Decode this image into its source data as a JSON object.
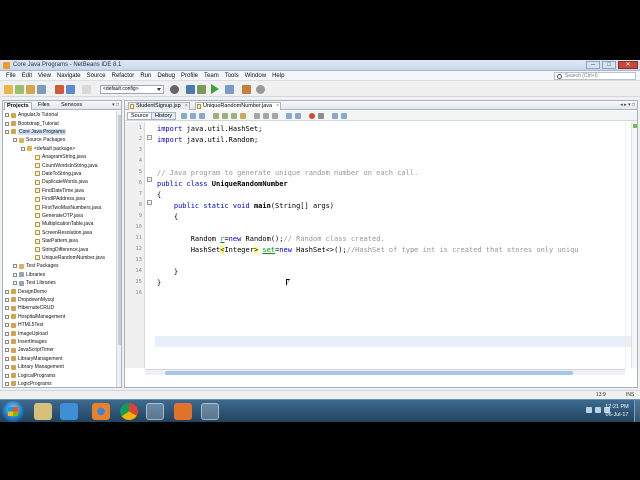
{
  "window": {
    "title": "Core Java Programs - NetBeans IDE 8.1",
    "controls": [
      "─",
      "□",
      "✕"
    ]
  },
  "menu": [
    "File",
    "Edit",
    "View",
    "Navigate",
    "Source",
    "Refactor",
    "Run",
    "Debug",
    "Profile",
    "Team",
    "Tools",
    "Window",
    "Help"
  ],
  "search": {
    "placeholder": "Search (Ctrl+I)"
  },
  "toolbar": {
    "config": "<default config>"
  },
  "panel": {
    "tabs": [
      "Projects",
      "Files",
      "Services"
    ],
    "controls": "▾ □"
  },
  "tree": [
    {
      "label": "AngularJs Tutorial",
      "type": "project",
      "depth": 0
    },
    {
      "label": "Bootstrap_Tutorial",
      "type": "project",
      "depth": 0
    },
    {
      "label": "Core Java Programs",
      "type": "project",
      "depth": 0,
      "selected": true
    },
    {
      "label": "Source Packages",
      "type": "folder",
      "depth": 1
    },
    {
      "label": "<default package>",
      "type": "package",
      "depth": 2
    },
    {
      "label": "AnagramString.java",
      "type": "java",
      "depth": 3
    },
    {
      "label": "CountWordsInString.java",
      "type": "java",
      "depth": 3
    },
    {
      "label": "DateToString.java",
      "type": "java",
      "depth": 3
    },
    {
      "label": "DuplicateWords.java",
      "type": "java",
      "depth": 3
    },
    {
      "label": "FindDateTime.java",
      "type": "java",
      "depth": 3
    },
    {
      "label": "FindIPAddress.java",
      "type": "java",
      "depth": 3
    },
    {
      "label": "FirstTwoMaxNumbers.java",
      "type": "java",
      "depth": 3
    },
    {
      "label": "GenerateOTP.java",
      "type": "java",
      "depth": 3
    },
    {
      "label": "MultiplicationTable.java",
      "type": "java",
      "depth": 3
    },
    {
      "label": "ScreenResolution.java",
      "type": "java",
      "depth": 3
    },
    {
      "label": "StarPattern.java",
      "type": "java",
      "depth": 3
    },
    {
      "label": "StringDifference.java",
      "type": "java",
      "depth": 3
    },
    {
      "label": "UniqueRandomNumber.java",
      "type": "java",
      "depth": 3
    },
    {
      "label": "Test Packages",
      "type": "folder",
      "depth": 1
    },
    {
      "label": "Libraries",
      "type": "lib",
      "depth": 1
    },
    {
      "label": "Test Libraries",
      "type": "lib",
      "depth": 1
    },
    {
      "label": "DesignDemo",
      "type": "project",
      "depth": 0
    },
    {
      "label": "DropdownMysql",
      "type": "project",
      "depth": 0
    },
    {
      "label": "HibernateCRUD",
      "type": "project",
      "depth": 0
    },
    {
      "label": "HospitalManagement",
      "type": "project",
      "depth": 0
    },
    {
      "label": "HTML5Test",
      "type": "project",
      "depth": 0
    },
    {
      "label": "ImageUpload",
      "type": "project",
      "depth": 0
    },
    {
      "label": "InsertImages",
      "type": "project",
      "depth": 0
    },
    {
      "label": "JavaScriptTimer",
      "type": "project",
      "depth": 0
    },
    {
      "label": "LibraryManagement",
      "type": "project",
      "depth": 0
    },
    {
      "label": "Library Management",
      "type": "project",
      "depth": 0
    },
    {
      "label": "LogicalPrograms",
      "type": "project",
      "depth": 0
    },
    {
      "label": "LogicPrograms",
      "type": "project",
      "depth": 0
    }
  ],
  "editor": {
    "tabs": [
      "StudentSignup.jsp",
      "UniqueRandomNumber.java"
    ],
    "modes": [
      "Source",
      "History"
    ],
    "line_numbers": [
      "1",
      "2",
      "3",
      "4",
      "5",
      "6",
      "7",
      "8",
      "9",
      "10",
      "11",
      "12",
      "13",
      "14",
      "15",
      "16"
    ],
    "code": {
      "l1_kw": "import",
      "l1_rest": " java.util.HashSet;",
      "l2_kw": "import",
      "l2_rest": " java.util.Random;",
      "l5_comment": "// Java program to generate unique random number on each call.",
      "l6_kw": "public class",
      "l6_name": "UniqueRandomNumber",
      "l7": "{",
      "l8_kw": "public static void",
      "l8_name": "main",
      "l8_rest": "(String[] args)",
      "l9": "{",
      "l11_a": "Random ",
      "l11_var": "r",
      "l11_eq": "=",
      "l11_new": "new",
      "l11_b": " Random();",
      "l11_comment": "// Random class created.",
      "l12_a": "HashSet",
      "l12_gen_open": "<",
      "l12_gen": "Integer",
      "l12_gen_close": ">",
      "l12_var": "set",
      "l12_eq": "=",
      "l12_new": "new",
      "l12_b": " HashSet<>();",
      "l12_comment": "//HashSet of type int is created that stores only uniqu",
      "l14": "}",
      "l15": "}"
    }
  },
  "status": {
    "position": "13:9",
    "mode": "INS"
  },
  "taskbar": {
    "time": "12:21 PM",
    "date": "06-Jul-17"
  }
}
